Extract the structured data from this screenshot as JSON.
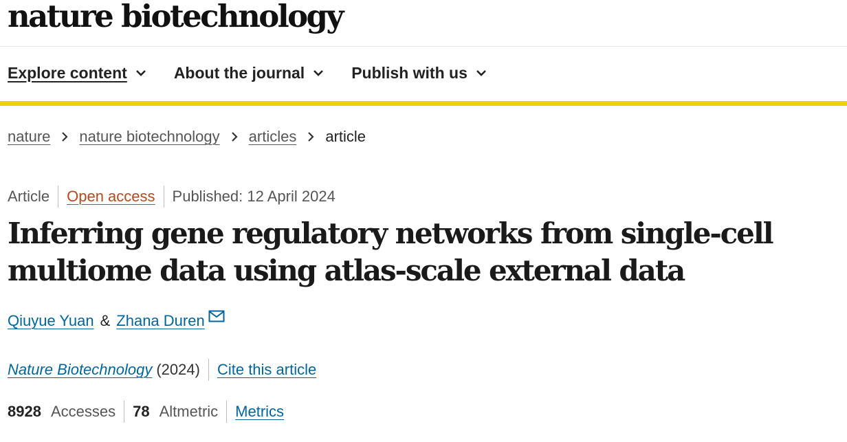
{
  "masthead": {
    "logo_text": "nature biotechnology"
  },
  "nav": {
    "items": [
      {
        "label": "Explore content",
        "icon": "chevron-down-icon"
      },
      {
        "label": "About the journal",
        "icon": "chevron-down-icon"
      },
      {
        "label": "Publish with us",
        "icon": "chevron-down-icon"
      }
    ],
    "accent_color": "#e9d400"
  },
  "breadcrumb": {
    "items": [
      "nature",
      "nature biotechnology",
      "articles"
    ],
    "current": "article",
    "separator_icon": "chevron-right-icon"
  },
  "meta": {
    "type": "Article",
    "access": "Open access",
    "published": "Published: 12 April 2024"
  },
  "article": {
    "title": "Inferring gene regulatory networks from single-cell multiome data using atlas-scale external data"
  },
  "authors": {
    "list": [
      "Qiuyue Yuan",
      "Zhana Duren"
    ],
    "joiner": "&",
    "contact_icon": "mail-icon"
  },
  "journal": {
    "name": "Nature Biotechnology",
    "year": "(2024)",
    "cite_label": "Cite this article"
  },
  "metrics": {
    "accesses_value": "8928",
    "accesses_label": "Accesses",
    "altmetric_value": "78",
    "altmetric_label": "Altmetric",
    "link_label": "Metrics"
  },
  "colors": {
    "link": "#006699",
    "open_access": "#b24a1f"
  }
}
